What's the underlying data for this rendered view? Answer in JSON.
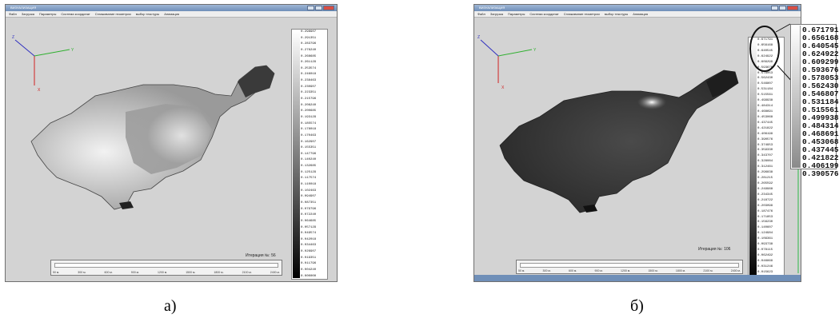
{
  "panels": [
    {
      "window_title": "ВИЗУАЛИЗАЦИЯ",
      "menu": [
        "Файл",
        "Загрузка",
        "Параметры",
        "Система координат",
        "Сглаживание геометрии",
        "выбор текстуры",
        "Анимация"
      ],
      "axes": {
        "x": "X",
        "y": "Y",
        "z": "Z"
      },
      "iteration_label": "Итерация №: 56",
      "scale_values": [
        "0.298907",
        "0.291351",
        "0.283796",
        "0.276240",
        "0.268685",
        "0.261129",
        "0.253574",
        "0.246018",
        "0.238463",
        "0.230907",
        "0.223351",
        "0.215796",
        "0.208240",
        "0.200685",
        "0.193129",
        "0.185574",
        "0.178018",
        "0.170463",
        "0.162907",
        "0.155351",
        "0.147796",
        "0.140240",
        "0.132685",
        "0.125129",
        "0.117574",
        "0.110018",
        "0.102463",
        "0.094907",
        "0.087351",
        "0.079796",
        "0.072240",
        "0.064685",
        "0.057129",
        "0.049574",
        "0.042018",
        "0.034463",
        "0.026907",
        "0.019351",
        "0.011796",
        "0.004240",
        "0.000000"
      ],
      "ruler_ticks": [
        "50 м.",
        "300 м.",
        "600 м.",
        "900 м.",
        "1200 м.",
        "1500 м.",
        "1800 м.",
        "2100 м.",
        "2400 м."
      ],
      "caption": "а)"
    },
    {
      "window_title": "ВИЗУАЛИЗАЦИЯ",
      "menu": [
        "Файл",
        "Загрузка",
        "Параметры",
        "Система координат",
        "Сглаживание геометрии",
        "выбор текстуры",
        "Анимация"
      ],
      "axes": {
        "x": "X",
        "y": "Y",
        "z": "Z"
      },
      "iteration_label": "Итерация №: 106",
      "scale_values": [
        "0.671791",
        "0.656168",
        "0.640545",
        "0.624922",
        "0.609299",
        "0.593676",
        "0.578053",
        "0.562430",
        "0.546807",
        "0.531184",
        "0.515561",
        "0.499938",
        "0.484314",
        "0.468691",
        "0.453068",
        "0.437445",
        "0.421822",
        "0.406199",
        "0.390576",
        "0.374953",
        "0.359330",
        "0.343707",
        "0.328084",
        "0.312461",
        "0.296838",
        "0.281215",
        "0.265592",
        "0.249968",
        "0.234345",
        "0.218722",
        "0.203099",
        "0.187476",
        "0.171853",
        "0.156230",
        "0.140607",
        "0.124984",
        "0.109361",
        "0.093738",
        "0.078115",
        "0.062492",
        "0.046869",
        "0.031246",
        "0.015623",
        "0.000000"
      ],
      "ruler_ticks": [
        "50 м.",
        "300 м.",
        "600 м.",
        "900 м.",
        "1200 м.",
        "1500 м.",
        "1800 м.",
        "2100 м.",
        "2400 м."
      ],
      "caption": "б)"
    }
  ],
  "zoom_scale": [
    "0.671791",
    "0.656168",
    "0.640545",
    "0.624922",
    "0.609299",
    "0.593676",
    "0.578053",
    "0.562430",
    "0.546807",
    "0.531184",
    "0.515561",
    "0.499938",
    "0.484314",
    "0.468691",
    "0.453068",
    "0.437445",
    "0.421822",
    "0.406199",
    "0.390576"
  ]
}
